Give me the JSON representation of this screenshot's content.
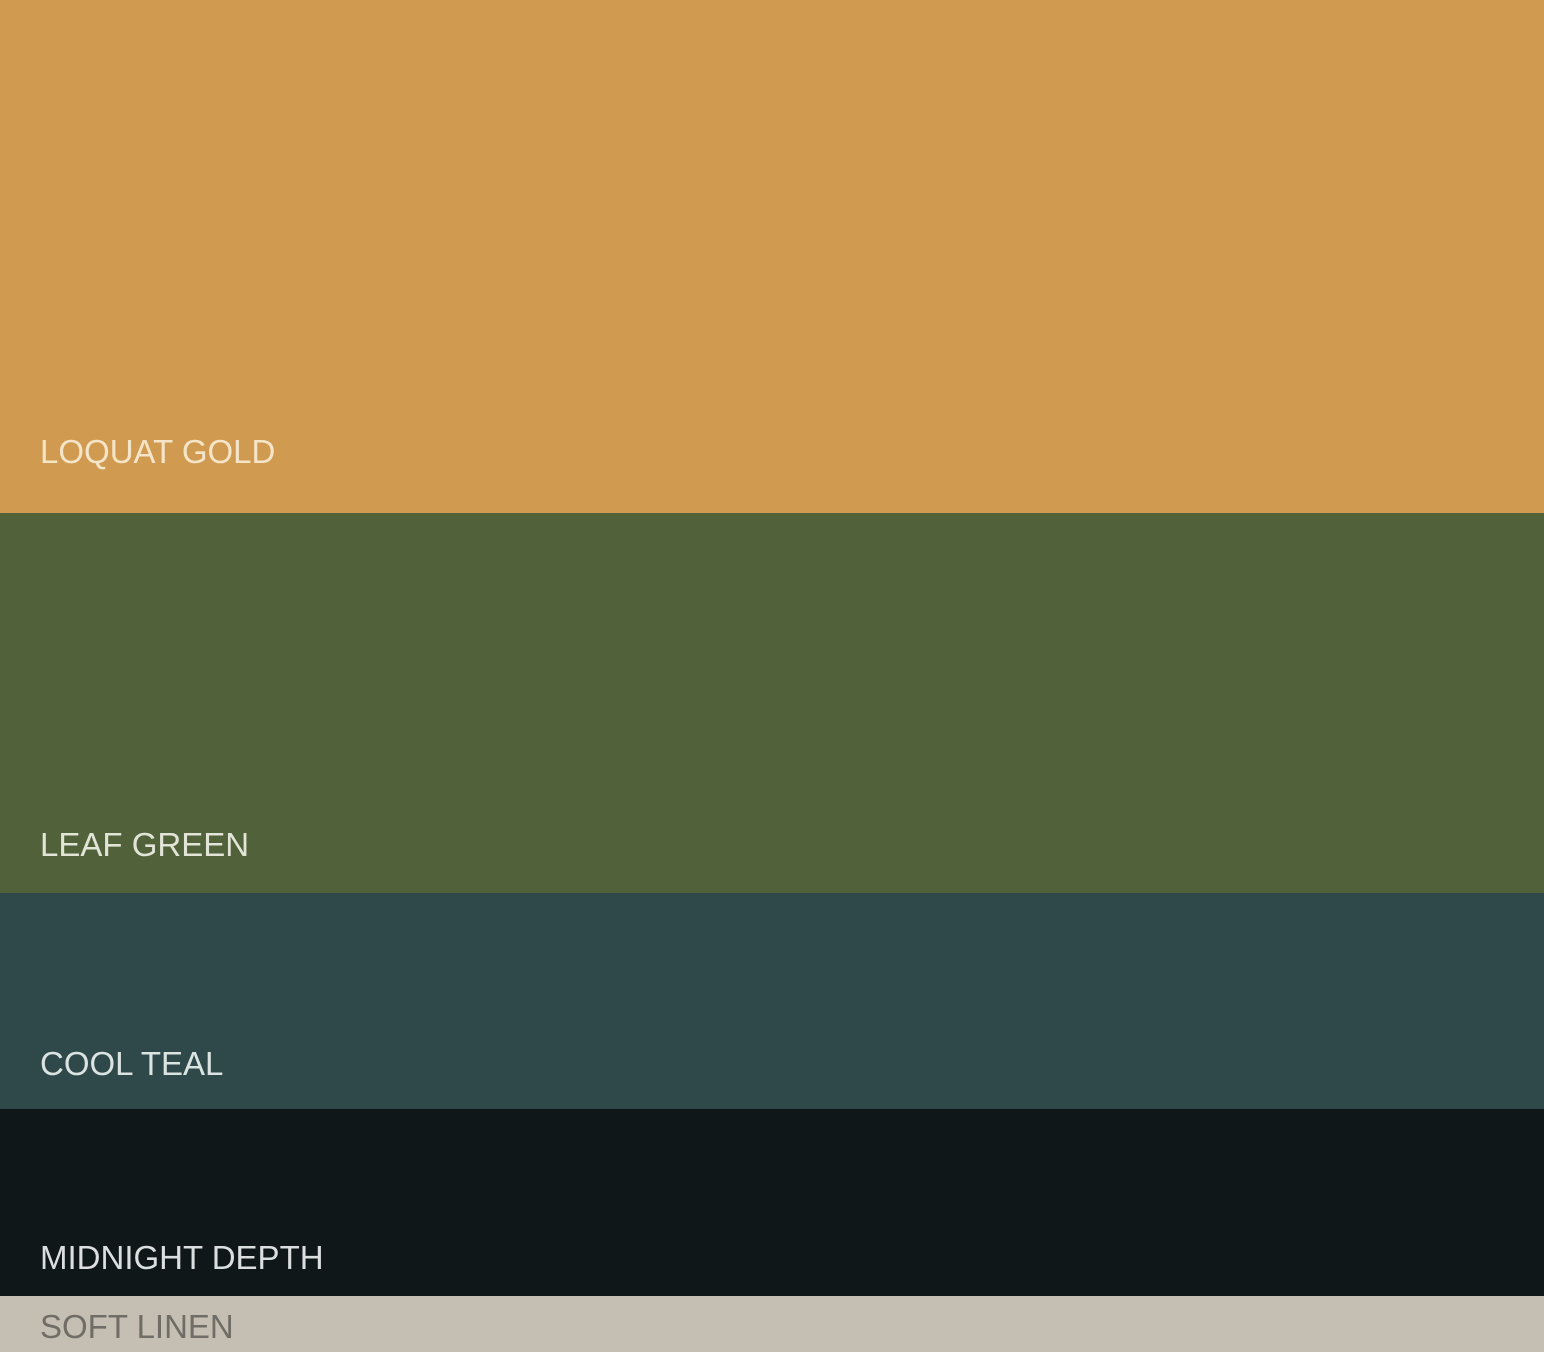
{
  "swatches": [
    {
      "name": "LOQUAT GOLD",
      "color": "#D09B51"
    },
    {
      "name": "LEAF GREEN",
      "color": "#516139"
    },
    {
      "name": "COOL TEAL",
      "color": "#2F494B"
    },
    {
      "name": "MIDNIGHT DEPTH",
      "color": "#0F1719"
    },
    {
      "name": "SOFT LINEN",
      "color": "#C4BFB2"
    }
  ]
}
